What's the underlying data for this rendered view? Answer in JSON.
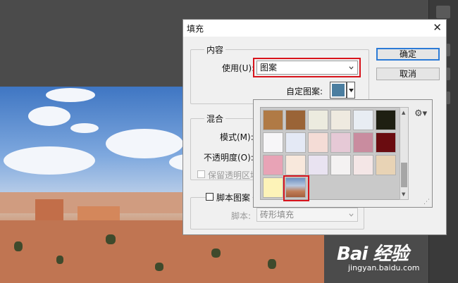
{
  "dialog": {
    "title": "填充",
    "content_group": {
      "legend": "内容",
      "use_label": "使用(U):",
      "use_value": "图案",
      "custom_pattern_label": "自定图案:"
    },
    "buttons": {
      "ok": "确定",
      "cancel": "取消"
    },
    "blend_group": {
      "legend": "混合",
      "mode_label": "模式(M):",
      "opacity_label": "不透明度(O):",
      "preserve_label": "保留透明区域"
    },
    "script_group": {
      "checkbox_label": "脚本图案",
      "script_label": "脚本:",
      "script_value": "砖形填充"
    }
  },
  "pattern_picker": {
    "swatches": [
      {
        "name": "pattern-1",
        "color": "#b07a45"
      },
      {
        "name": "pattern-2",
        "color": "#9a6437"
      },
      {
        "name": "pattern-3",
        "color": "#ecebdf"
      },
      {
        "name": "pattern-4",
        "color": "#efeae0"
      },
      {
        "name": "pattern-5",
        "color": "#e8edf3"
      },
      {
        "name": "pattern-6",
        "color": "#1e1f12"
      },
      {
        "name": "pattern-7",
        "color": "#f7f6f8"
      },
      {
        "name": "pattern-8",
        "color": "#e4e9f5"
      },
      {
        "name": "pattern-9",
        "color": "#f4dcd6"
      },
      {
        "name": "pattern-10",
        "color": "#e6c9d6"
      },
      {
        "name": "pattern-11",
        "color": "#c98c9f"
      },
      {
        "name": "pattern-12",
        "color": "#6a0c10"
      },
      {
        "name": "pattern-13",
        "color": "#e8a3b6"
      },
      {
        "name": "pattern-14",
        "color": "#f8e8dc"
      },
      {
        "name": "pattern-15",
        "color": "#e9e3f1"
      },
      {
        "name": "pattern-16",
        "color": "#f4f2f2"
      },
      {
        "name": "pattern-17",
        "color": "#f4e6e6"
      },
      {
        "name": "pattern-18",
        "color": "#e8d3b5"
      },
      {
        "name": "pattern-19",
        "color": "#fdf3b8"
      },
      {
        "name": "pattern-20",
        "color": "#b97c5e"
      }
    ],
    "selected_index": 19
  },
  "watermark": {
    "logo": "Bai 经验",
    "url": "jingyan.baidu.com"
  },
  "colors": {
    "highlight": "#d8141c",
    "default_button": "#2c7bd6",
    "pattern_preview": "#4b7ea0"
  }
}
